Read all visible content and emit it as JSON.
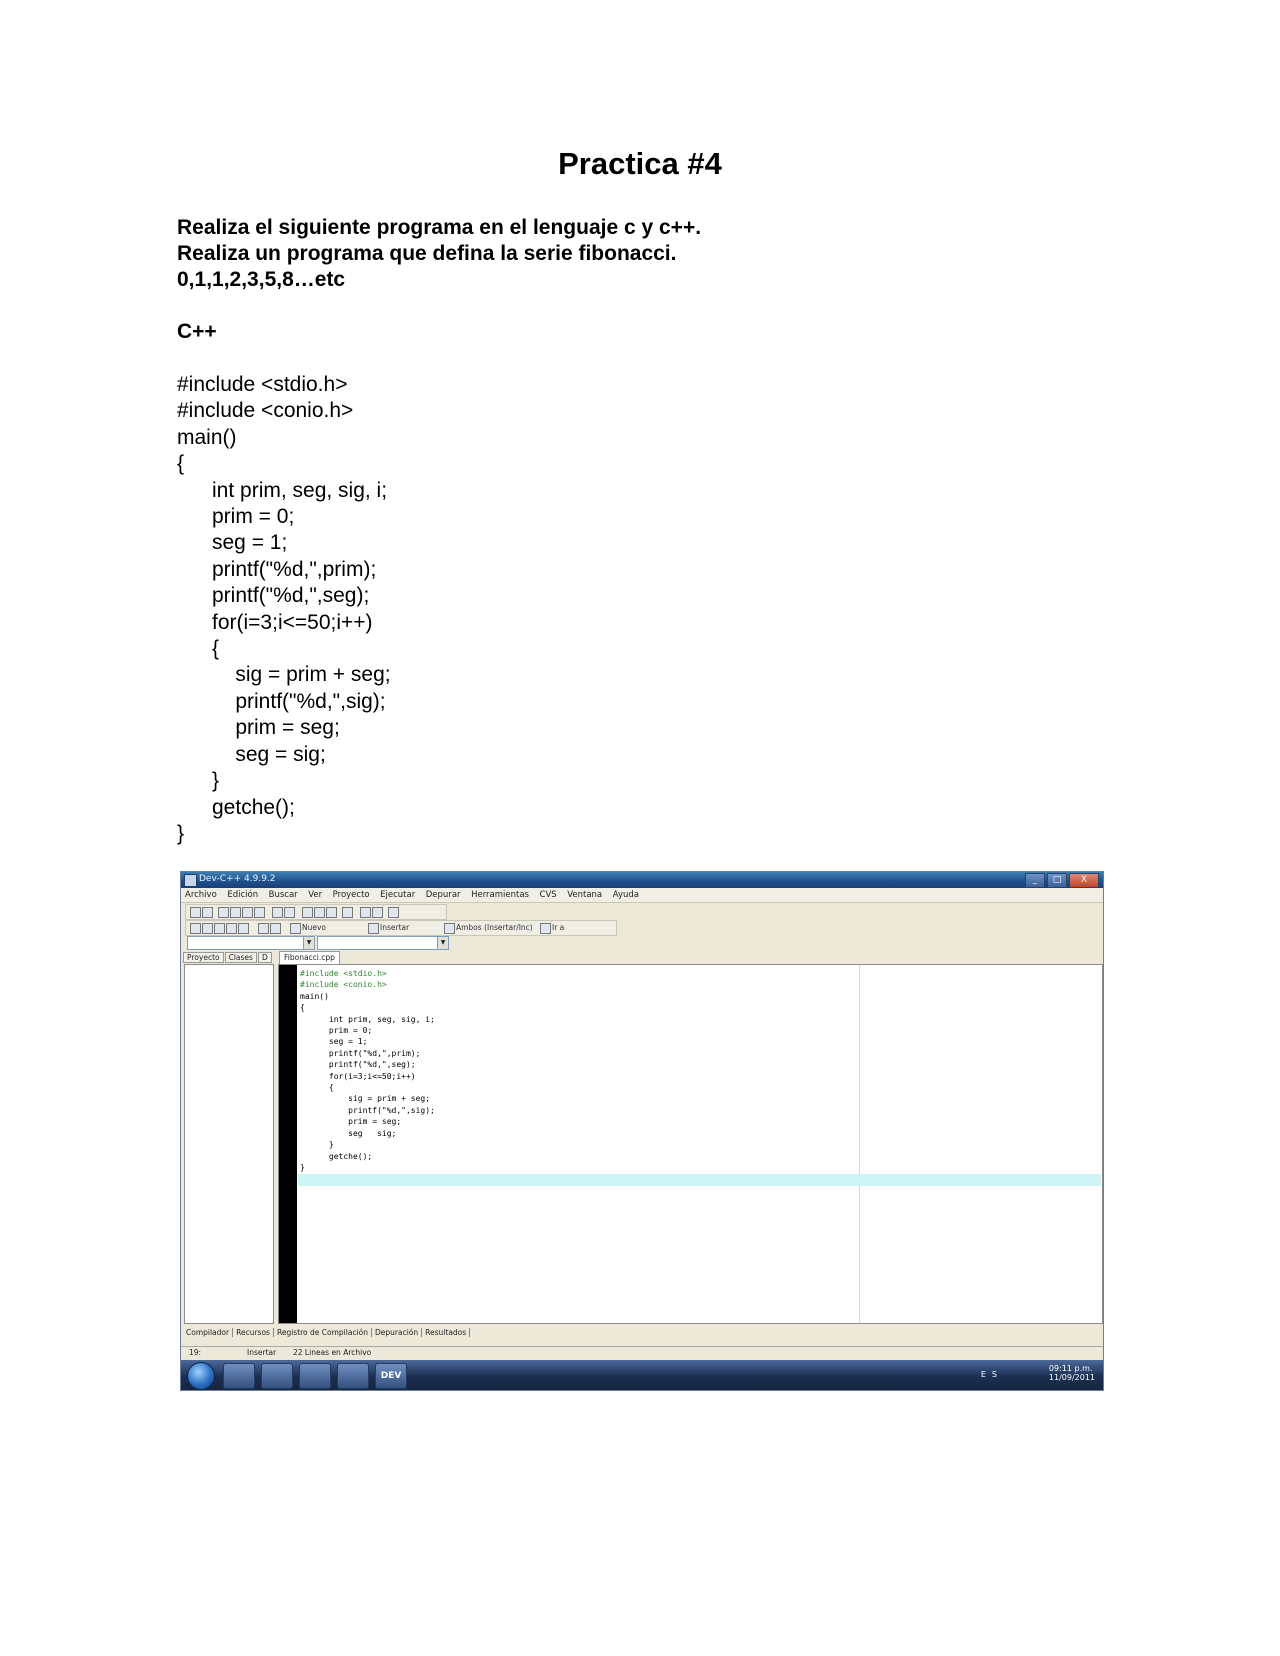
{
  "document": {
    "title": "Practica #4",
    "intro_lines": [
      "Realiza el siguiente programa en el lenguaje c y c++.",
      "Realiza un programa que defina la serie fibonacci.",
      "0,1,1,2,3,5,8…etc"
    ],
    "language_heading": "C++",
    "code_lines": [
      "#include <stdio.h>",
      "#include <conio.h>",
      "main()",
      "{",
      "      int prim, seg, sig, i;",
      "      prim = 0;",
      "      seg = 1;",
      "      printf(\"%d,\",prim);",
      "      printf(\"%d,\",seg);",
      "      for(i=3;i<=50;i++)",
      "      {",
      "          sig = prim + seg;",
      "          printf(\"%d,\",sig);",
      "          prim = seg;",
      "          seg = sig;",
      "      }",
      "      getche();",
      "}"
    ]
  },
  "screenshot": {
    "window_title": "Dev-C++ 4.9.9.2",
    "window_buttons": [
      "_",
      "□",
      "X"
    ],
    "menu": [
      "Archivo",
      "Edición",
      "Buscar",
      "Ver",
      "Proyecto",
      "Ejecutar",
      "Depurar",
      "Herramientas",
      "CVS",
      "Ventana",
      "Ayuda"
    ],
    "toolbar_labels": [
      "Nuevo",
      "Insertar",
      "Ambos (Insertar/Inc)",
      "Ir a"
    ],
    "left_tabs": [
      "Proyecto",
      "Clases",
      "D"
    ],
    "file_tab": "Fibonacci.cpp",
    "editor_lines": [
      "#include <stdio.h>",
      "#include <conio.h>",
      "main()",
      "{",
      "      int prim, seg, sig, i;",
      "      prim = 0;",
      "      seg = 1;",
      "      printf(\"%d,\",prim);",
      "      printf(\"%d,\",seg);",
      "      for(i=3;i<=50;i++)",
      "      {",
      "          sig = prim + seg;",
      "          printf(\"%d,\",sig);",
      "          prim = seg;",
      "          seg   sig;",
      "      }",
      "      getche();",
      "}"
    ],
    "bottom_tabs": [
      "Compilador",
      "Recursos",
      "Registro de Compilación",
      "Depuración",
      "Resultados"
    ],
    "status": {
      "position": "19:",
      "mode": "Insertar",
      "lines": "22 Lineas en Archivo"
    },
    "taskbar": {
      "dev_label": "DEV",
      "lang": "ES",
      "time": "09:11 p.m.",
      "date": "11/09/2011"
    }
  }
}
